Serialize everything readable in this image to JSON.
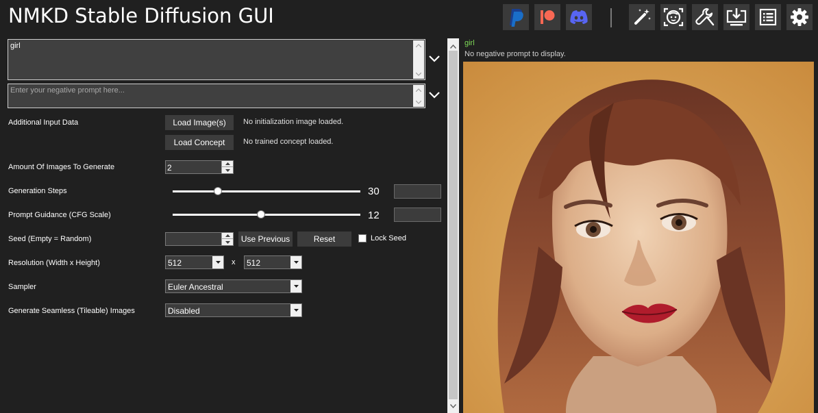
{
  "app": {
    "title": "NMKD Stable Diffusion GUI"
  },
  "toolbar": {
    "items": [
      {
        "name": "paypal-button",
        "icon": "paypal-icon"
      },
      {
        "name": "patreon-button",
        "icon": "patreon-icon"
      },
      {
        "name": "discord-button",
        "icon": "discord-icon"
      },
      {
        "name": "post-processing-button",
        "icon": "magic-wand-icon"
      },
      {
        "name": "face-restoration-button",
        "icon": "face-icon"
      },
      {
        "name": "tools-button",
        "icon": "wrench-icon"
      },
      {
        "name": "install-button",
        "icon": "download-monitor-icon"
      },
      {
        "name": "logs-button",
        "icon": "list-icon"
      },
      {
        "name": "settings-button",
        "icon": "gear-icon"
      }
    ]
  },
  "prompt": {
    "value": "girl",
    "negative_placeholder": "Enter your negative prompt here..."
  },
  "form": {
    "additional_input": {
      "label": "Additional Input Data",
      "load_image_label": "Load Image(s)",
      "load_image_info": "No initialization image loaded.",
      "load_concept_label": "Load Concept",
      "load_concept_info": "No trained concept loaded."
    },
    "amount": {
      "label": "Amount Of Images To Generate",
      "value": "2"
    },
    "steps": {
      "label": "Generation Steps",
      "value": "30",
      "fraction": 0.24
    },
    "cfg": {
      "label": "Prompt Guidance (CFG Scale)",
      "value": "12",
      "fraction": 0.47
    },
    "seed": {
      "label": "Seed (Empty = Random)",
      "value": "",
      "use_previous_label": "Use Previous",
      "reset_label": "Reset",
      "lock_label": "Lock Seed",
      "locked": false
    },
    "resolution": {
      "label": "Resolution (Width x Height)",
      "width": "512",
      "separator": "x",
      "height": "512"
    },
    "sampler": {
      "label": "Sampler",
      "value": "Euler Ancestral"
    },
    "seamless": {
      "label": "Generate Seamless (Tileable) Images",
      "value": "Disabled"
    }
  },
  "preview": {
    "prompt": "girl",
    "negative_info": "No negative prompt to display."
  },
  "colors": {
    "background": "#202020",
    "accent_green": "#7ed957",
    "paypal_blue": "#1a6ec8",
    "patreon_red": "#f96854",
    "discord_blue": "#5865f2"
  }
}
